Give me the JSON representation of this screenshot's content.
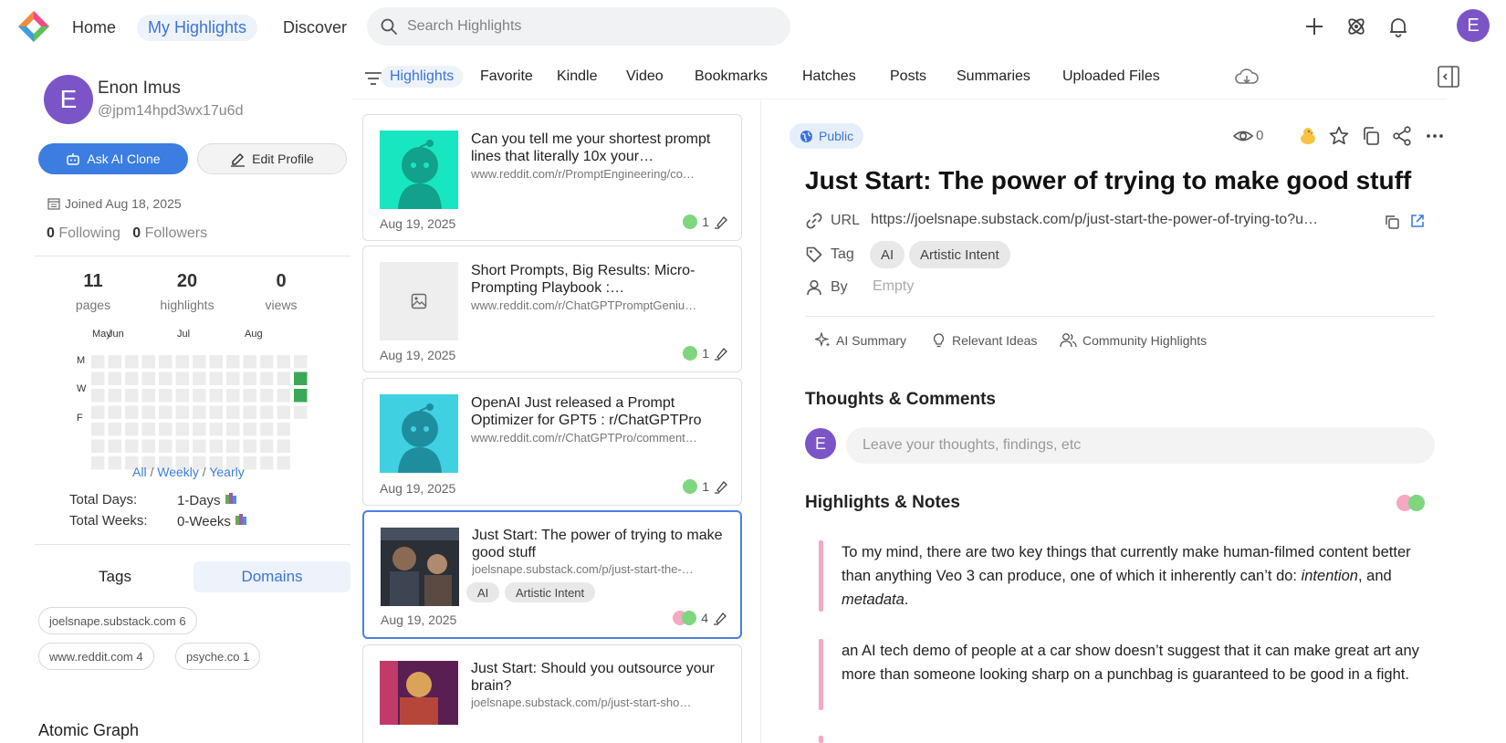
{
  "nav": {
    "home": "Home",
    "my_highlights": "My Highlights",
    "discover": "Discover",
    "search_placeholder": "Search Highlights",
    "user_initial": "E"
  },
  "profile": {
    "initial": "E",
    "name": "Enon Imus",
    "handle": "@jpm14hpd3wx17u6d",
    "ask_button": "Ask AI Clone",
    "edit_button": "Edit Profile",
    "joined": "Joined Aug 18, 2025",
    "following_count": "0",
    "following_label": "Following",
    "followers_count": "0",
    "followers_label": "Followers"
  },
  "stats": [
    {
      "value": "11",
      "label": "pages"
    },
    {
      "value": "20",
      "label": "highlights"
    },
    {
      "value": "0",
      "label": "views"
    }
  ],
  "activity": {
    "months": [
      "May",
      "Jun",
      "Jul",
      "Aug"
    ],
    "days": [
      "M",
      "W",
      "F"
    ],
    "range_all": "All",
    "range_weekly": "Weekly",
    "range_yearly": "Yearly",
    "range_sep": "/",
    "total_days_label": "Total Days:",
    "total_days_value": "1-Days",
    "total_weeks_label": "Total Weeks:",
    "total_weeks_value": "0-Weeks",
    "empty_color": "#ececec",
    "active_color": "#3aa856"
  },
  "left_tabs": {
    "tags": "Tags",
    "domains": "Domains"
  },
  "domains": [
    {
      "label": "joelsnape.substack.com 6"
    },
    {
      "label": "www.reddit.com 4"
    },
    {
      "label": "psyche.co 1"
    }
  ],
  "atomic_graph": "Atomic Graph",
  "subtabs": [
    "Highlights",
    "Favorite",
    "Kindle",
    "Video",
    "Bookmarks",
    "Hatches",
    "Posts",
    "Summaries",
    "Uploaded Files"
  ],
  "cards": [
    {
      "title": "Can you tell me your shortest prompt lines that literally 10x your…",
      "url": "www.reddit.com/r/PromptEngineering/co…",
      "date": "Aug 19, 2025",
      "count": "1",
      "thumb": "reddit-green",
      "tags": []
    },
    {
      "title": "Short Prompts, Big Results: Micro-Prompting Playbook :…",
      "url": "www.reddit.com/r/ChatGPTPromptGeniu…",
      "date": "Aug 19, 2025",
      "count": "1",
      "thumb": "placeholder",
      "tags": []
    },
    {
      "title": "OpenAI Just released a Prompt Optimizer for GPT5 : r/ChatGPTPro",
      "url": "www.reddit.com/r/ChatGPTPro/comment…",
      "date": "Aug 19, 2025",
      "count": "1",
      "thumb": "reddit-cyan",
      "tags": []
    },
    {
      "title": "Just Start: The power of trying to make good stuff",
      "url": "joelsnape.substack.com/p/just-start-the-…",
      "date": "Aug 19, 2025",
      "count": "4",
      "thumb": "photo-dark",
      "tags": [
        "AI",
        "Artistic Intent"
      ]
    },
    {
      "title": "Just Start: Should you outsource your brain?",
      "url": "joelsnape.substack.com/p/just-start-sho…",
      "date": "",
      "count": "",
      "thumb": "photo-robot",
      "tags": []
    }
  ],
  "detail": {
    "visibility": "Public",
    "views": "0",
    "title": "Just Start: The power of trying to make good stuff",
    "url_label": "URL",
    "url": "https://joelsnape.substack.com/p/just-start-the-power-of-trying-to?u…",
    "tag_label": "Tag",
    "tags": [
      "AI",
      "Artistic Intent"
    ],
    "by_label": "By",
    "by_value": "Empty",
    "tools": [
      "AI Summary",
      "Relevant Ideas",
      "Community Highlights"
    ],
    "thoughts_heading": "Thoughts & Comments",
    "comment_initial": "E",
    "comment_placeholder": "Leave your thoughts, findings, etc",
    "highlights_heading": "Highlights & Notes",
    "highlight1_a": "To my mind, there are two key things that currently make human-filmed content better than anything Veo 3 can produce, one of which it inherently can’t do: ",
    "highlight1_b": "intention",
    "highlight1_c": ", and ",
    "highlight1_d": "metadata",
    "highlight1_e": ".",
    "highlight2": "an AI tech demo of people at a car show doesn’t suggest that it can make great art any more than someone looking sharp on a punchbag is guaranteed to be good in a fight."
  },
  "colors": {
    "accent": "#3b7de0",
    "avatar": "#7b55c8",
    "highlight_pink": "#f5a8c2",
    "highlight_green": "#7ed67e"
  }
}
